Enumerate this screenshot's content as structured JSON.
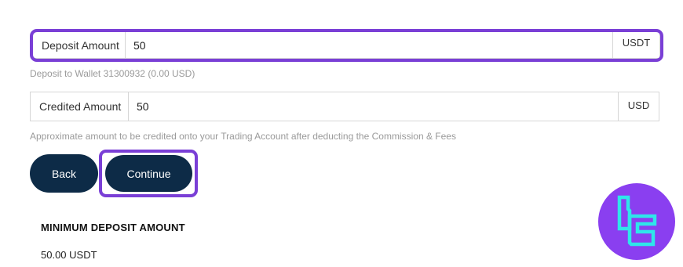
{
  "deposit": {
    "label": "Deposit Amount",
    "value": "50",
    "currency": "USDT",
    "hint": "Deposit to Wallet 31300932 (0.00 USD)"
  },
  "credited": {
    "label": "Credited Amount",
    "value": "50",
    "currency": "USD",
    "hint": "Approximate amount to be credited onto your Trading Account after deducting the Commission & Fees"
  },
  "buttons": {
    "back_label": "Back",
    "continue_label": "Continue"
  },
  "minimum": {
    "title": "MINIMUM DEPOSIT AMOUNT",
    "value": "50.00 USDT"
  },
  "theme": {
    "button_color": "#0d2b47",
    "highlight_color": "#7a3fd6",
    "logo_bg": "#8a3ff0",
    "logo_accent": "#2ee6ea"
  },
  "icons": {
    "brand": "brand-logo-icon"
  }
}
